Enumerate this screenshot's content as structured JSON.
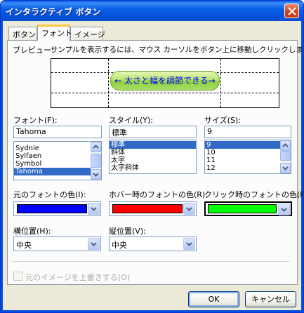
{
  "window": {
    "title": "インタラクティブ ボタン"
  },
  "tabs": [
    {
      "label": "ボタン"
    },
    {
      "label": "フォント"
    },
    {
      "label": "イメージ"
    }
  ],
  "preview": {
    "label": "プレビュー:",
    "hint": "サンプルを表示するには、マウス カーソルをボタン上に移動しクリックします。",
    "button_text": "← 太さと幅を調節できる→"
  },
  "font": {
    "label": "フォント(F):",
    "value": "Tahoma",
    "items": [
      "Sydnie",
      "Sylfaen",
      "Symbol",
      "Tahoma"
    ],
    "selected": "Tahoma"
  },
  "style": {
    "label": "スタイル(Y):",
    "value": "標準",
    "items": [
      "標準",
      "斜体",
      "太字",
      "太字斜体"
    ],
    "selected": "標準"
  },
  "size": {
    "label": "サイズ(S):",
    "value": "9",
    "items": [
      "9",
      "10",
      "11",
      "12"
    ],
    "selected": "9"
  },
  "colors": {
    "original_label": "元のフォントの色(I):",
    "hover_label": "ホバー時のフォントの色(R):",
    "click_label": "クリック時のフォントの色(P):",
    "original": "#0000ff",
    "hover": "#ff0000",
    "click": "#00ff00"
  },
  "alignment": {
    "horizontal_label": "横位置(H):",
    "horizontal_value": "中央",
    "vertical_label": "縦位置(V):",
    "vertical_value": "中央"
  },
  "overwrite": {
    "label": "元のイメージを上書きする(O)",
    "checked": false
  },
  "buttons": {
    "ok": "OK",
    "cancel": "キャンセル"
  }
}
